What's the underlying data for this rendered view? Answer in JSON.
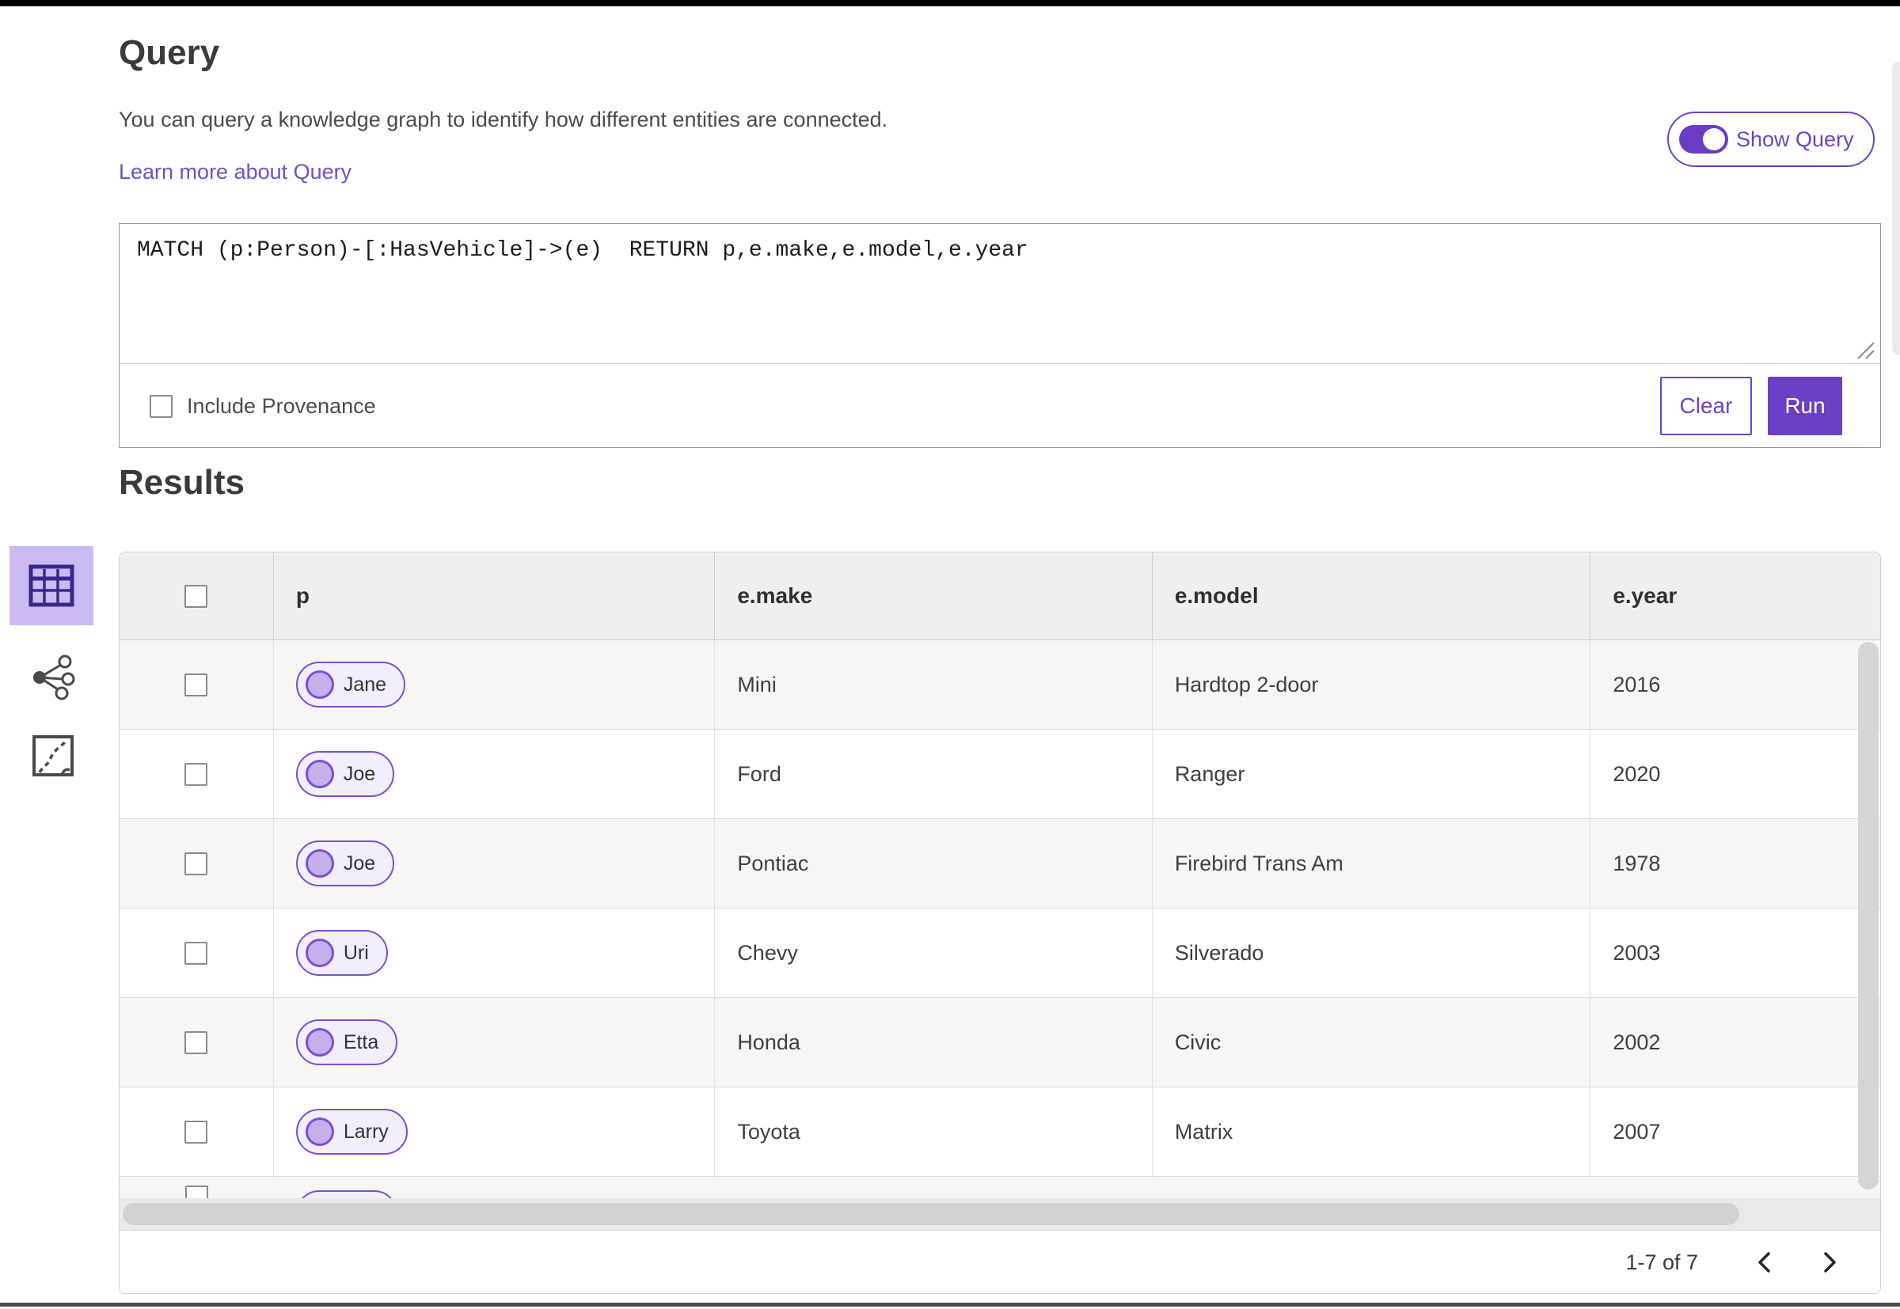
{
  "colors": {
    "accent": "#6a43c8",
    "run_button_bg": "#6b40c6",
    "link": "#6d52cc",
    "selected_view_bg": "#ccbaf3",
    "pill_border": "#7a4ed8",
    "table_header_bg": "#f0efed",
    "alt_row_bg": "#f7f6f4"
  },
  "query_panel": {
    "title": "Query",
    "description": "You can query a knowledge graph to identify how different entities are connected.",
    "learn_more_link": "Learn more about Query",
    "show_query_toggle": {
      "label": "Show Query",
      "state": "on"
    },
    "query_input": {
      "value": "MATCH (p:Person)-[:HasVehicle]->(e)  RETURN p,e.make,e.model,e.year"
    },
    "include_provenance": {
      "label": "Include Provenance",
      "checked": false
    },
    "clear_button": "Clear",
    "run_button": "Run"
  },
  "results_panel": {
    "title": "Results",
    "view_switcher": [
      {
        "name": "table-view",
        "selected": true
      },
      {
        "name": "graph-view",
        "selected": false
      },
      {
        "name": "map-view",
        "selected": false
      }
    ],
    "table": {
      "columns": [
        "p",
        "e.make",
        "e.model",
        "e.year"
      ],
      "rows": [
        {
          "p": "Jane",
          "e_make": "Mini",
          "e_model": "Hardtop 2-door",
          "e_year": "2016"
        },
        {
          "p": "Joe",
          "e_make": "Ford",
          "e_model": "Ranger",
          "e_year": "2020"
        },
        {
          "p": "Joe",
          "e_make": "Pontiac",
          "e_model": "Firebird Trans Am",
          "e_year": "1978"
        },
        {
          "p": "Uri",
          "e_make": "Chevy",
          "e_model": "Silverado",
          "e_year": "2003"
        },
        {
          "p": "Etta",
          "e_make": "Honda",
          "e_model": "Civic",
          "e_year": "2002"
        },
        {
          "p": "Larry",
          "e_make": "Toyota",
          "e_model": "Matrix",
          "e_year": "2007"
        }
      ],
      "partial_row_visible": true
    },
    "pagination": {
      "range_label": "1-7 of 7"
    }
  }
}
